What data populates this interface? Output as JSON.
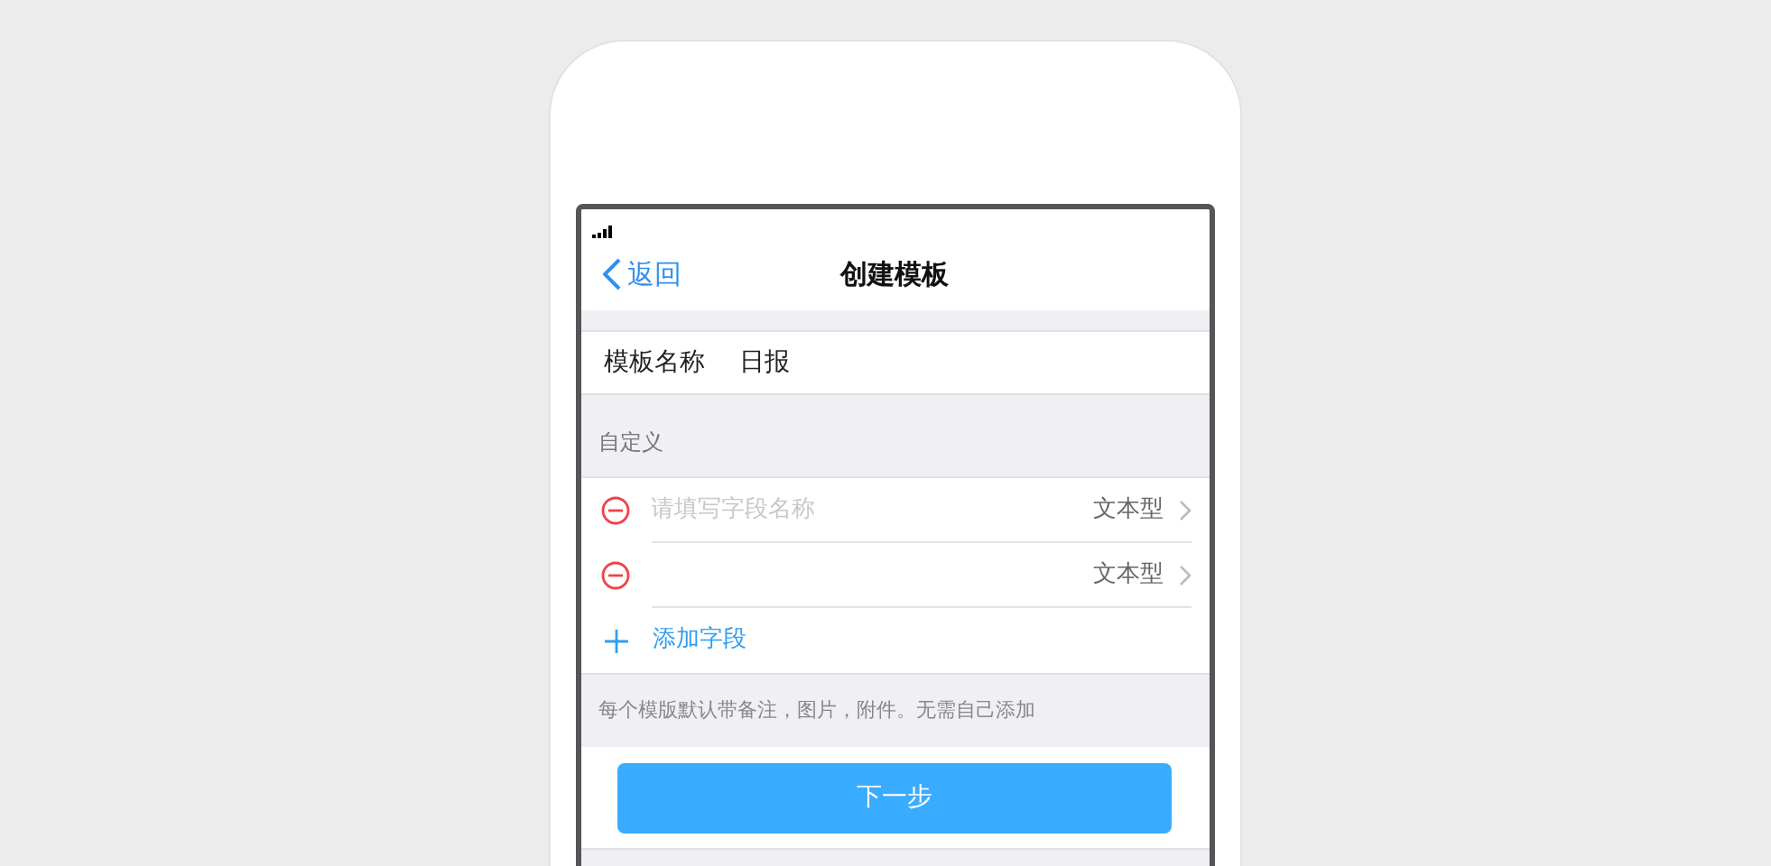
{
  "nav": {
    "back": "返回",
    "title": "创建模板"
  },
  "name_row": {
    "label": "模板名称",
    "value": "日报"
  },
  "section_header": "自定义",
  "fields": [
    {
      "placeholder": "请填写字段名称",
      "type": "文本型"
    },
    {
      "type": "文本型"
    }
  ],
  "add_field": "添加字段",
  "footnote": "每个模版默认带备注，图片，附件。无需自己添加",
  "next_button": "下一步"
}
